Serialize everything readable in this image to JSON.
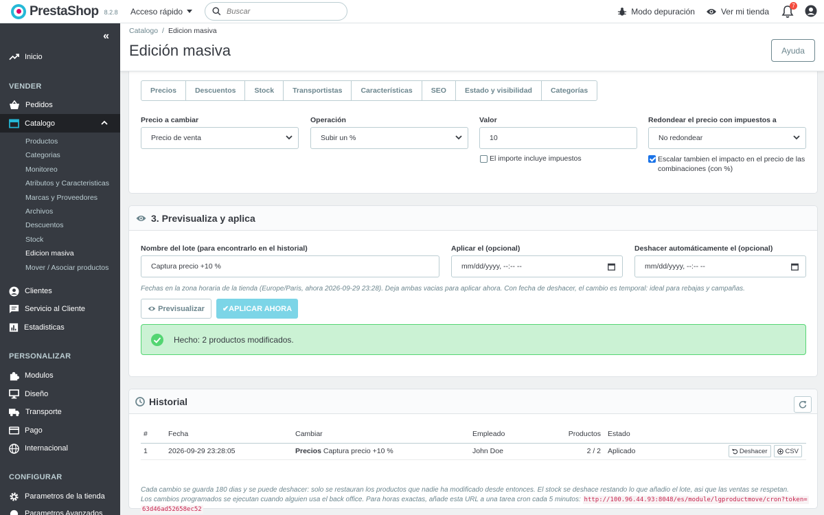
{
  "header": {
    "brand": "PrestaShop",
    "version": "8.2.8",
    "quick_access": "Acceso rápido",
    "search_placeholder": "Buscar",
    "debug_mode": "Modo depuración",
    "view_store": "Ver mi tienda",
    "notifications_count": "7"
  },
  "sidebar": {
    "collapse": "«",
    "home": "Inicio",
    "section_sell": "VENDER",
    "orders": "Pedidos",
    "catalog": "Catalogo",
    "catalog_sub": [
      "Productos",
      "Categorias",
      "Monitoreo",
      "Atributos y Caracteristicas",
      "Marcas y Proveedores",
      "Archivos",
      "Descuentos",
      "Stock",
      "Edicion masiva",
      "Mover / Asociar productos"
    ],
    "customers": "Clientes",
    "customer_service": "Servicio al Cliente",
    "stats": "Estadisticas",
    "section_customize": "PERSONALIZAR",
    "modules": "Modulos",
    "design": "Diseño",
    "shipping": "Transporte",
    "payment": "Pago",
    "international": "Internacional",
    "section_configure": "CONFIGURAR",
    "shop_params": "Parametros de la tienda",
    "advanced_params": "Parametros Avanzados"
  },
  "page": {
    "breadcrumb_parent": "Catalogo",
    "breadcrumb_sep": "/",
    "breadcrumb_current": "Edicion masiva",
    "title": "Edición masiva",
    "help": "Ayuda"
  },
  "step2": {
    "tabs": [
      "Precios",
      "Descuentos",
      "Stock",
      "Transportistas",
      "Características",
      "SEO",
      "Estado y visibilidad",
      "Categorías"
    ],
    "price_label": "Precio a cambiar",
    "price_value": "Precio de venta",
    "operation_label": "Operación",
    "operation_value": "Subir un %",
    "value_label": "Valor",
    "value_value": "10",
    "round_label": "Redondear el precio con impuestos a",
    "round_value": "No redondear",
    "include_tax": "El importe incluye impuestos",
    "scale_combinations": "Escalar tambien el impacto en el precio de las combinaciones (con %)"
  },
  "step3": {
    "title": "3. Previsualiza y aplica",
    "batch_label": "Nombre del lote (para encontrarlo en el historial)",
    "batch_value": "Captura precio +10 %",
    "apply_label": "Aplicar el (opcional)",
    "apply_placeholder": "mm/dd/yyyy, --:-- --",
    "undo_label": "Deshacer automáticamente el (opcional)",
    "undo_placeholder": "mm/dd/yyyy, --:-- --",
    "note": "Fechas en la zona horaria de la tienda (Europe/Paris, ahora 2026-09-29 23:28). Deja ambas vacias para aplicar ahora. Con fecha de deshacer, el cambio es temporal: ideal para rebajas y campañas.",
    "preview_btn": "Previsualizar",
    "apply_btn": "✔APLICAR AHORA",
    "success": "Hecho: 2 productos modificados."
  },
  "history": {
    "title": "Historial",
    "columns": [
      "#",
      "Fecha",
      "Cambiar",
      "Empleado",
      "Productos",
      "Estado"
    ],
    "rows": [
      {
        "id": "1",
        "date": "2026-09-29 23:28:05",
        "type": "Precios",
        "desc": "Captura precio +10 %",
        "employee": "John Doe",
        "products": "2 / 2",
        "status": "Aplicado"
      }
    ],
    "undo_btn": "Deshacer",
    "csv_btn": "CSV",
    "note1": "Cada cambio se guarda 180 dias y se puede deshacer: solo se restauran los productos que nadie ha modificado desde entonces. El stock se deshace restando lo que añadio el lote, asi que las ventas se respetan.",
    "note2": "Los cambios programados se ejecutan cuando alguien usa el back office. Para horas exactas, añade esta URL a una tarea cron cada 5 minutos:",
    "cron_url_1": "http://100.96.44.93:8048/es/module/lgproductmove/cron?token=",
    "cron_url_2": "63d46ad52658ec52"
  },
  "colors": {
    "accent": "#25b9d7",
    "sidebar": "#363a41",
    "success": "#53d572"
  }
}
